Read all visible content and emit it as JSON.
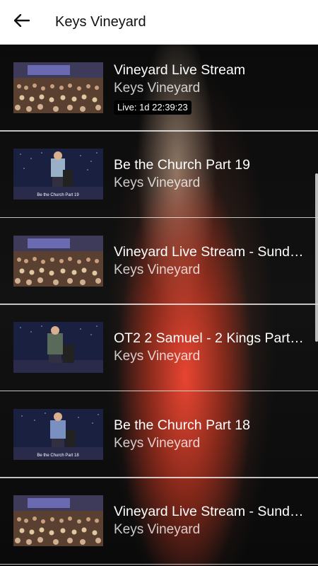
{
  "header": {
    "back_icon": "arrow-left-icon",
    "title": "Keys Vineyard"
  },
  "colors": {
    "header_bg": "#ffffff",
    "content_bg": "#000000",
    "glow_red": "#f04632",
    "text_primary": "#ffffff"
  },
  "videos": [
    {
      "title": "Vineyard Live Stream",
      "channel": "Keys Vineyard",
      "badge": "Live: 1d 22:39:23",
      "thumb": "congregation"
    },
    {
      "title": "Be the Church Part 19",
      "channel": "Keys Vineyard",
      "thumb_caption": "Be the Church Part 19",
      "thumb": "speaker-stage"
    },
    {
      "title": "Vineyard Live Stream - Sund…",
      "channel": "Keys Vineyard",
      "thumb": "congregation"
    },
    {
      "title": "OT2 2 Samuel - 2 Kings Part…",
      "channel": "Keys Vineyard",
      "thumb": "speaker-stage"
    },
    {
      "title": "Be the Church Part 18",
      "channel": "Keys Vineyard",
      "thumb_caption": "Be the Church Part 18",
      "thumb": "speaker-stage"
    },
    {
      "title": "Vineyard Live Stream - Sund…",
      "channel": "Keys Vineyard",
      "thumb": "congregation"
    }
  ]
}
